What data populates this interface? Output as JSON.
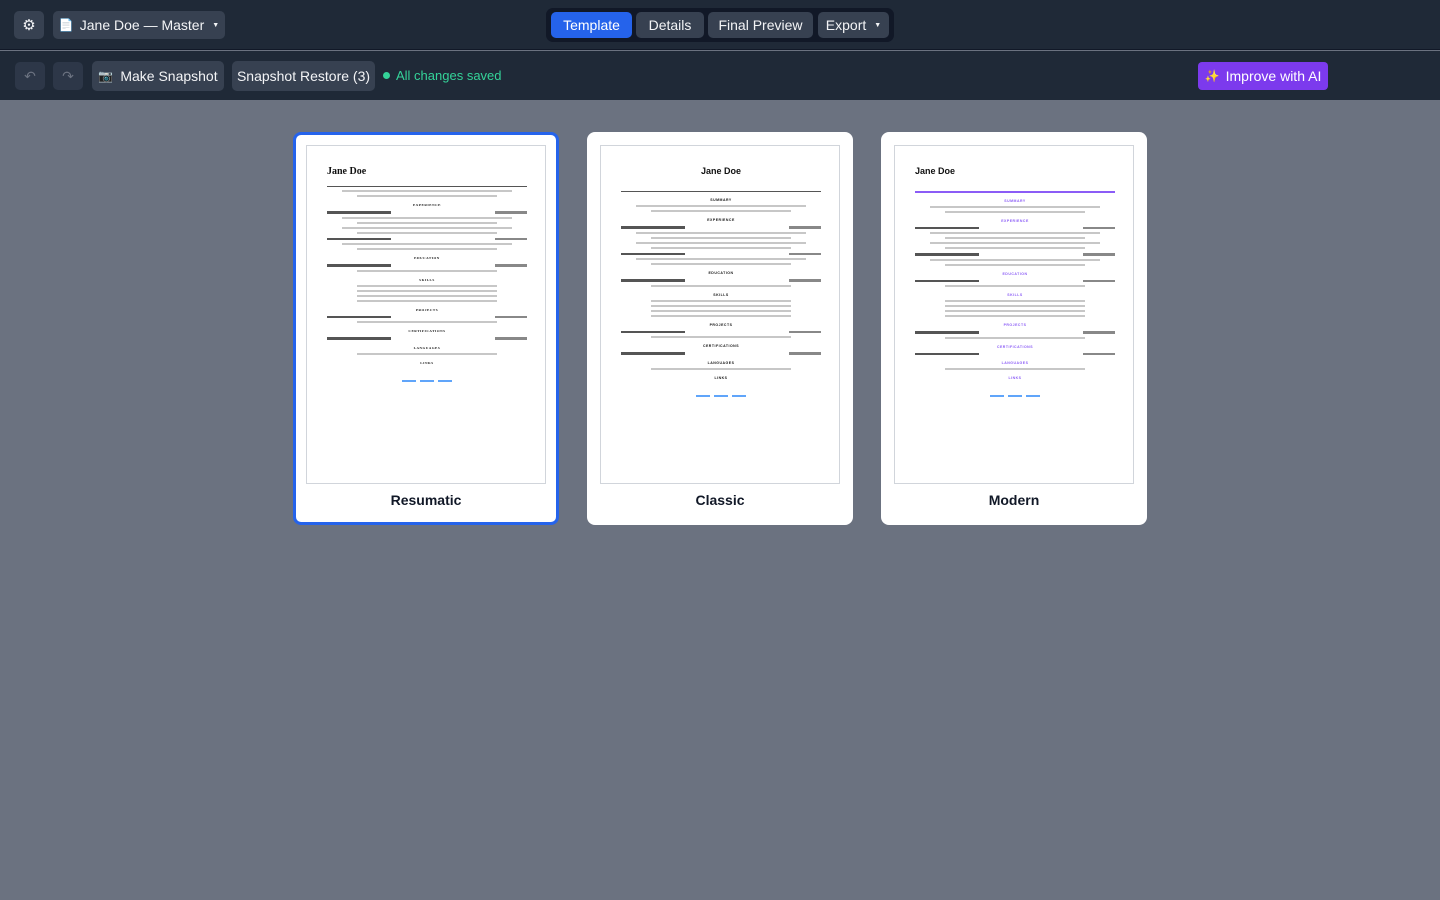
{
  "toolbar": {
    "settings_icon": "gear-icon",
    "doc_icon": "document-icon",
    "doc_name": "Jane Doe — Master",
    "tabs": [
      "Template",
      "Details",
      "Final Preview",
      "Export"
    ],
    "active_tab": "Template"
  },
  "subbar": {
    "undo_icon": "undo-icon",
    "redo_icon": "redo-icon",
    "snapshot_icon": "camera-icon",
    "snapshot_label": "Make Snapshot",
    "restore_label": "Snapshot Restore (3)",
    "status": "All changes saved",
    "ai_icon": "sparkles-icon",
    "ai_label": "Improve with AI"
  },
  "colors": {
    "accent": "#2563eb",
    "ai": "#7c3aed",
    "saved": "#34d399",
    "modern_accent": "#8b5cf6"
  },
  "templates": [
    {
      "name": "Resumatic",
      "selected": true,
      "preview": {
        "name": "Jane Doe",
        "sections": [
          "EXPERIENCE",
          "EDUCATION",
          "SKILLS",
          "PROJECTS",
          "CERTIFICATIONS",
          "LANGUAGES",
          "LINKS"
        ]
      }
    },
    {
      "name": "Classic",
      "selected": false,
      "preview": {
        "name": "Jane Doe",
        "sections": [
          "SUMMARY",
          "EXPERIENCE",
          "EDUCATION",
          "SKILLS",
          "PROJECTS",
          "CERTIFICATIONS",
          "LANGUAGES",
          "LINKS"
        ]
      }
    },
    {
      "name": "Modern",
      "selected": false,
      "preview": {
        "name": "Jane Doe",
        "sections": [
          "SUMMARY",
          "EXPERIENCE",
          "EDUCATION",
          "SKILLS",
          "PROJECTS",
          "CERTIFICATIONS",
          "LANGUAGES",
          "LINKS"
        ]
      }
    }
  ]
}
